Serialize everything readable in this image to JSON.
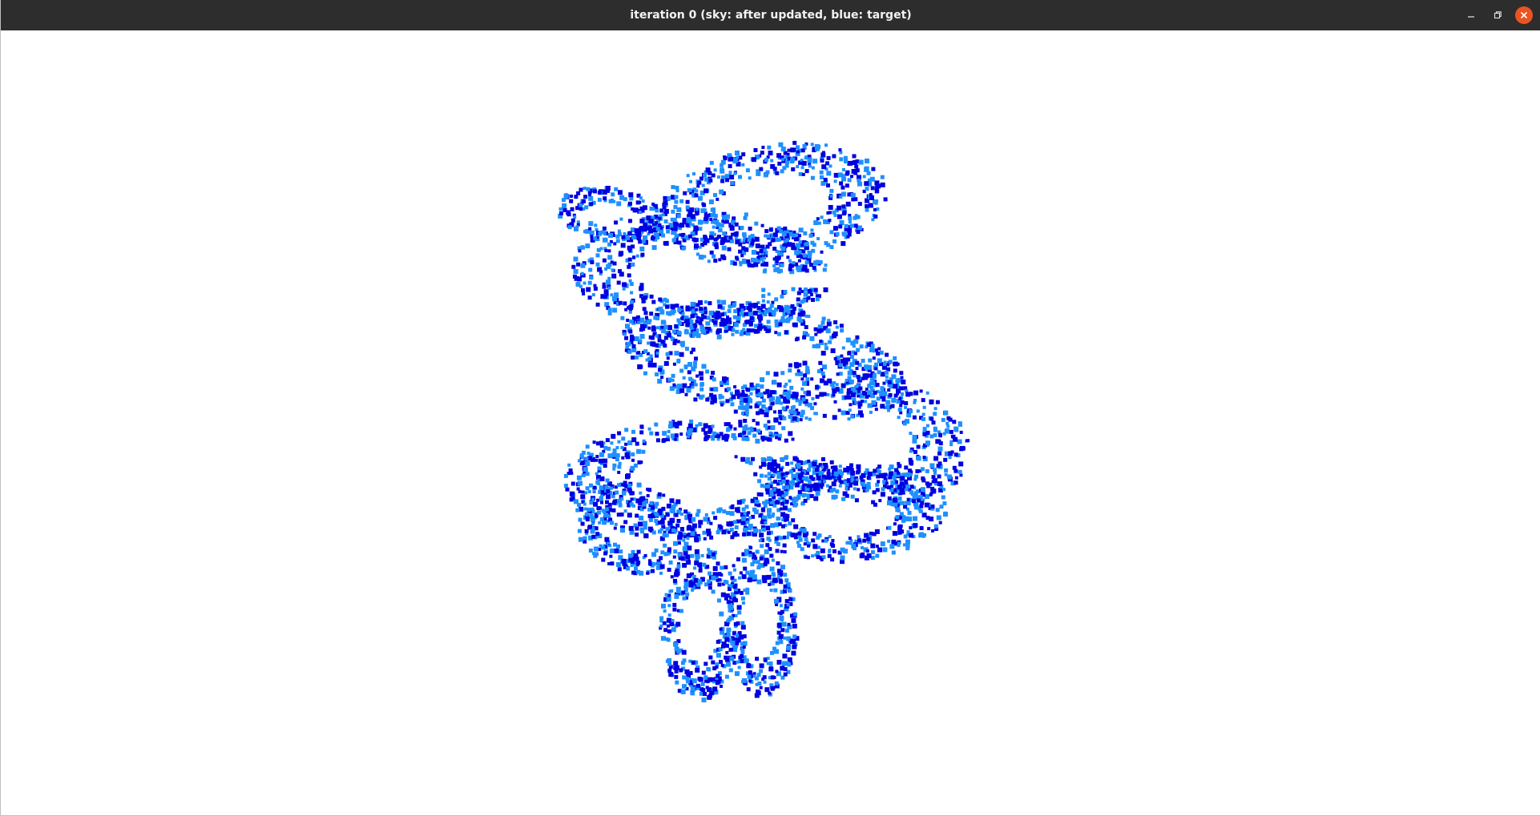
{
  "window": {
    "title": "iteration 0 (sky: after updated, blue: target)",
    "buttons": {
      "minimize_icon": "minimize-icon",
      "maximize_icon": "maximize-icon",
      "close_icon": "close-icon"
    },
    "colors": {
      "titlebar": "#2d2d2d",
      "close": "#e95420",
      "background": "#ffffff"
    }
  },
  "viewer": {
    "point_colors": {
      "after_updated": "#1e90ff",
      "target": "#0000e0"
    }
  }
}
